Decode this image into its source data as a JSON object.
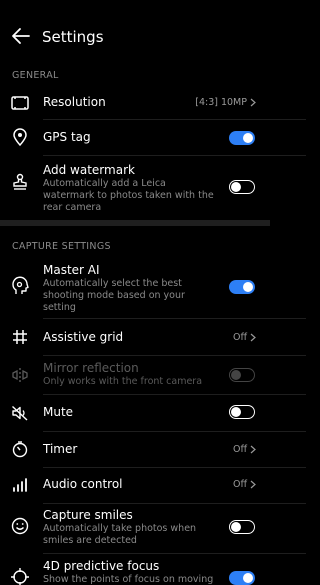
{
  "header": {
    "title": "Settings"
  },
  "sections": {
    "general": "GENERAL",
    "capture": "CAPTURE SETTINGS"
  },
  "general": {
    "resolution": {
      "label": "Resolution",
      "value": "[4:3] 10MP"
    },
    "gps": {
      "label": "GPS tag",
      "state": "on"
    },
    "watermark": {
      "label": "Add watermark",
      "sub": "Automatically add a Leica watermark to photos taken with the rear camera",
      "state": "off"
    }
  },
  "capture": {
    "master_ai": {
      "label": "Master AI",
      "sub": "Automatically select the best shooting mode based on your setting",
      "state": "on"
    },
    "grid": {
      "label": "Assistive grid",
      "value": "Off"
    },
    "mirror": {
      "label": "Mirror reflection",
      "sub": "Only works with the front camera",
      "state": "disabled"
    },
    "mute": {
      "label": "Mute",
      "state": "off"
    },
    "timer": {
      "label": "Timer",
      "value": "Off"
    },
    "audio": {
      "label": "Audio control",
      "value": "Off"
    },
    "smiles": {
      "label": "Capture smiles",
      "sub": "Automatically take photos when smiles are detected",
      "state": "off"
    },
    "focus": {
      "label": "4D predictive focus",
      "sub": "Show the points of focus on moving",
      "state": "on"
    }
  },
  "colors": {
    "accent": "#2d7ff5",
    "background": "#000000",
    "secondary_text": "#8a8a8a"
  }
}
